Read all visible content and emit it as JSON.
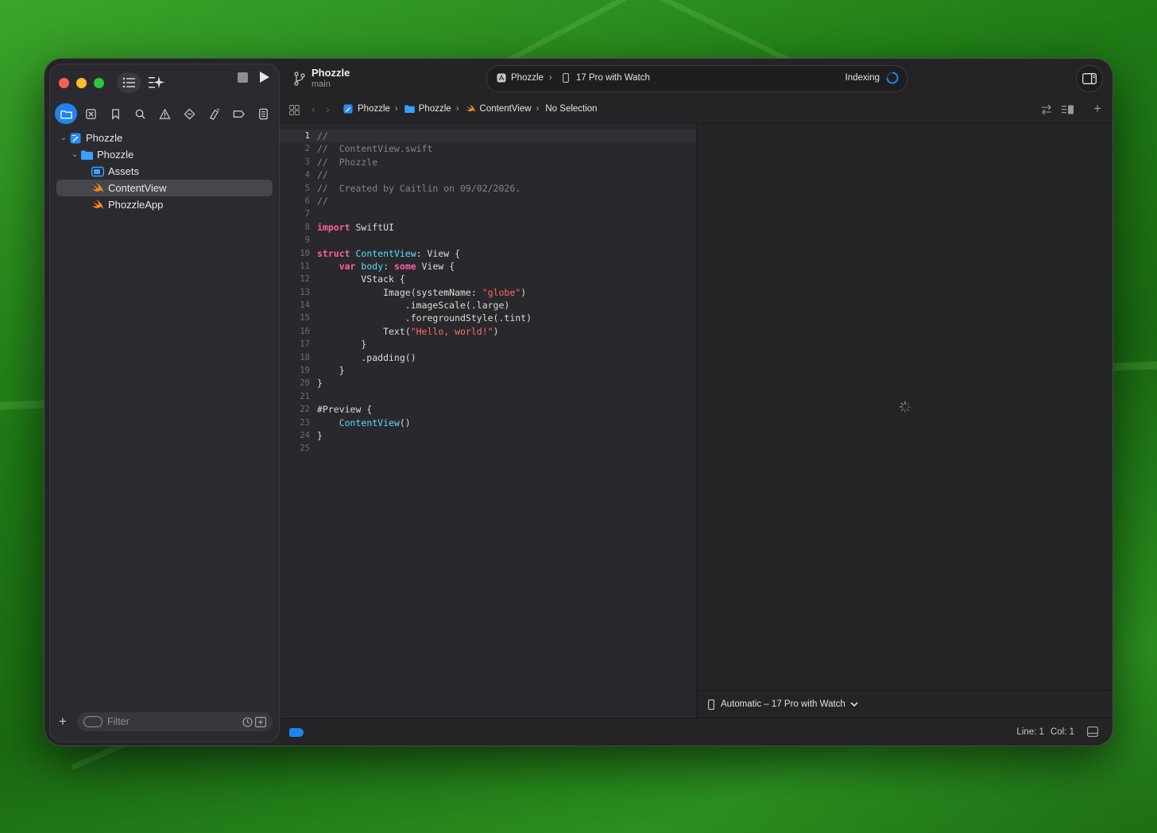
{
  "toolbar": {
    "project_title": "Phozzle",
    "branch": "main"
  },
  "activity": {
    "scheme": "Phozzle",
    "destination": "17 Pro with Watch",
    "status": "Indexing"
  },
  "jumpbar": {
    "crumbs": [
      "Phozzle",
      "Phozzle",
      "ContentView",
      "No Selection"
    ]
  },
  "navigator": {
    "tabs": [
      "folder-icon",
      "source-control-icon",
      "bookmark-icon",
      "search-icon",
      "warning-icon",
      "test-icon",
      "debug-icon",
      "breakpoint-icon",
      "report-icon"
    ],
    "tree": [
      {
        "label": "Phozzle",
        "icon": "project-icon",
        "level": 0
      },
      {
        "label": "Phozzle",
        "icon": "folder-icon",
        "level": 1
      },
      {
        "label": "Assets",
        "icon": "asset-catalog-icon",
        "level": 2
      },
      {
        "label": "ContentView",
        "icon": "swift-file-icon",
        "level": 2
      },
      {
        "label": "PhozzleApp",
        "icon": "swift-file-icon",
        "level": 2
      }
    ],
    "filter_placeholder": "Filter"
  },
  "editor": {
    "lines": [
      "//",
      "//  ContentView.swift",
      "//  Phozzle",
      "//",
      "//  Created by Caitlin on 09/02/2026.",
      "//",
      "",
      "import SwiftUI",
      "",
      "struct ContentView: View {",
      "    var body: some View {",
      "        VStack {",
      "            Image(systemName: \"globe\")",
      "                .imageScale(.large)",
      "                .foregroundStyle(.tint)",
      "            Text(\"Hello, world!\")",
      "        }",
      "        .padding()",
      "    }",
      "}",
      "",
      "#Preview {",
      "    ContentView()",
      "}",
      ""
    ]
  },
  "canvas": {
    "device_label": "Automatic – 17 Pro with Watch"
  },
  "statusbar": {
    "line_label": "Line: 1",
    "col_label": "Col: 1"
  },
  "colors": {
    "accent": "#1e84f0",
    "keyword": "#fc5fa3",
    "type": "#5dd8ff",
    "string": "#fc6a5d",
    "comment": "#7d8590"
  }
}
